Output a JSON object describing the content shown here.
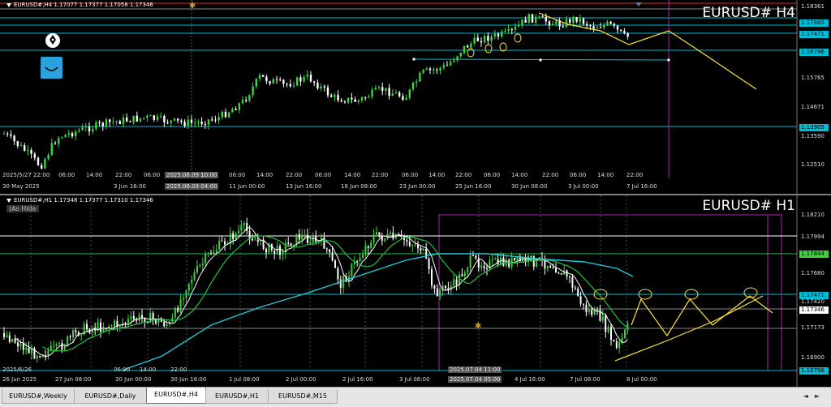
{
  "panel_h4": {
    "header": "EURUSD#,H4  1.17077 1.17377 1.17058 1.17346",
    "title": "EURUSD# H4",
    "price_labels": [
      "1.18361",
      "1.17865",
      "1.17471",
      "1.16796",
      "1.15765",
      "1.14671",
      "1.13905",
      "1.13590",
      "1.12510"
    ],
    "time_labels": [
      "2025/5/27 22:00",
      "30 May 2025",
      "06:00",
      "14:00",
      "3 Jun 16:00",
      "22:00",
      "06:00",
      "2025.06.09 10:00",
      "2025.06.09 04:00",
      "06:00",
      "11 Jun 00:00",
      "14:00",
      "22:00",
      "13 Jun 16:00",
      "06:00",
      "14:00",
      "18 Jun 08:00",
      "22:00",
      "23 Jun 00:00",
      "06:00",
      "14:00",
      "25 Jun 16:00",
      "22:00",
      "06:00",
      "14:00",
      "30 Jun 08:00",
      "22:00",
      "3 Jul 00:00",
      "06:00",
      "14:00",
      "7 Jul 16:00",
      "22:00"
    ]
  },
  "panel_h1": {
    "header": "EURUSD#,H1  1.17348 1.17377 1.17310 1.17346",
    "as_hide": "(As Hide",
    "title": "EURUSD# H1",
    "price_labels": [
      "1.18210",
      "1.17994",
      "1.17844",
      "1.17680",
      "1.17471",
      "1.17420",
      "1.17346",
      "1.17173",
      "1.16900",
      "1.16796"
    ],
    "time_labels": [
      "26 Jun 2025",
      "27 Jun 08:00",
      "30 Jun 00:00",
      "30 Jun 16:00",
      "1 Jul 08:00",
      "2 Jul 00:00",
      "2 Jul 16:00",
      "3 Jul 08:00",
      "2025.07.04 11:00",
      "2025.07.04 05:00",
      "4 Jul 16:00",
      "7 Jul 08:00",
      "8 Jul 00:00",
      "2025/6/26",
      "06:00",
      "14:00",
      "22:00"
    ]
  },
  "tabs": [
    "EURUSD#,Weekly",
    "EURUSD#,Daily",
    "EURUSD#,H4",
    "EURUSD#,H1",
    "EURUSD#,M15"
  ],
  "active_tab": "EURUSD#,H4",
  "colors": {
    "bull": "#3cd43c",
    "bear": "#ffffff",
    "hline": "#00bcd4",
    "drawing": "#ffe23a",
    "ma_cyan": "#22c6d8",
    "ma_green": "#22c040",
    "range_box": "#b020b0"
  },
  "icons": {
    "pen": "fountain-pen-icon",
    "smile": "smile-icon"
  }
}
